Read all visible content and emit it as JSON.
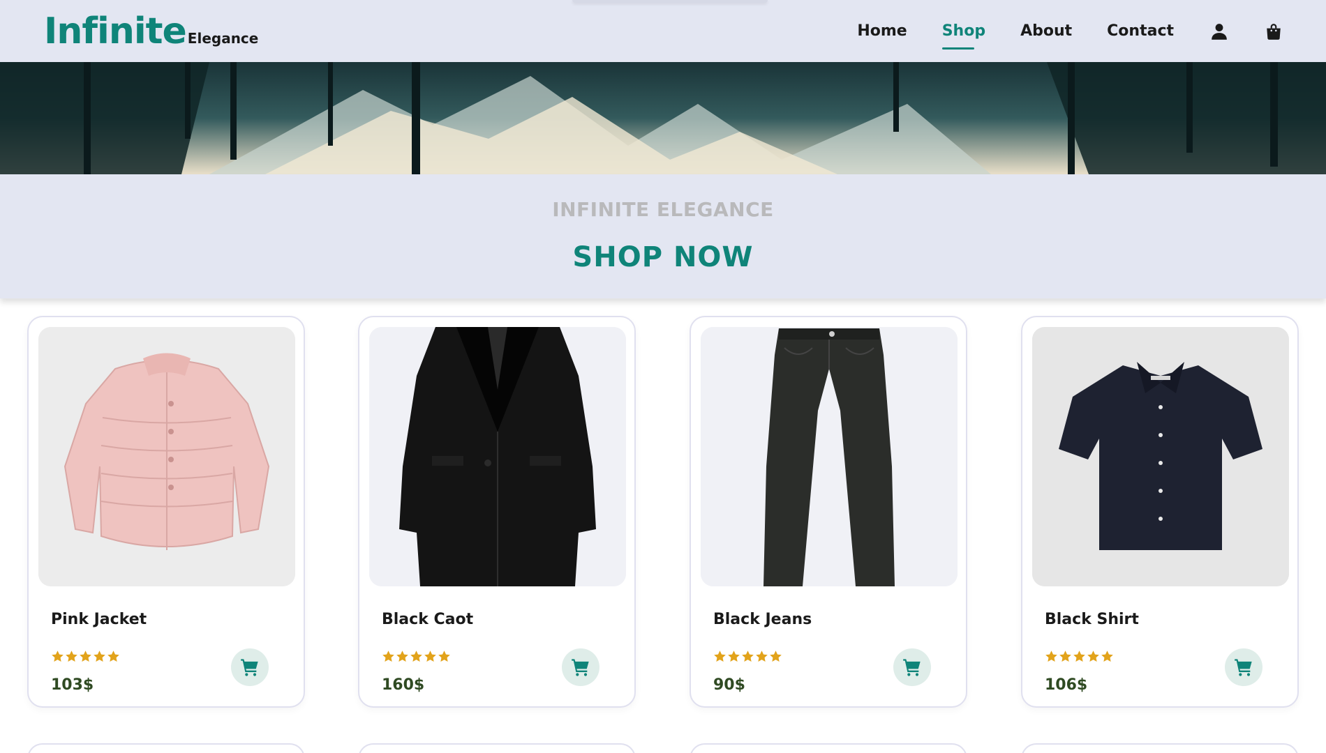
{
  "brand": {
    "main": "Infinite",
    "sub": "Elegance"
  },
  "nav": {
    "links": [
      {
        "label": "Home",
        "active": false
      },
      {
        "label": "Shop",
        "active": true
      },
      {
        "label": "About",
        "active": false
      },
      {
        "label": "Contact",
        "active": false
      }
    ],
    "icons": [
      "user-icon",
      "shopping-bag-icon"
    ]
  },
  "section": {
    "kicker": "INFINITE ELEGANCE",
    "title": "SHOP NOW"
  },
  "products": [
    {
      "name": "Pink Jacket",
      "price": "103$",
      "rating": 5,
      "image_icon": "pink-puffer-jacket-image"
    },
    {
      "name": "Black Caot",
      "price": "160$",
      "rating": 5,
      "image_icon": "black-coat-image"
    },
    {
      "name": "Black Jeans",
      "price": "90$",
      "rating": 5,
      "image_icon": "black-jeans-image"
    },
    {
      "name": "Black Shirt",
      "price": "106$",
      "rating": 5,
      "image_icon": "black-shirt-image"
    }
  ],
  "colors": {
    "accent": "#0f8479",
    "header_bg": "#e3e6f2",
    "star": "#e2a31b",
    "price": "#2f4a22",
    "cart_bg": "#dfede9"
  }
}
